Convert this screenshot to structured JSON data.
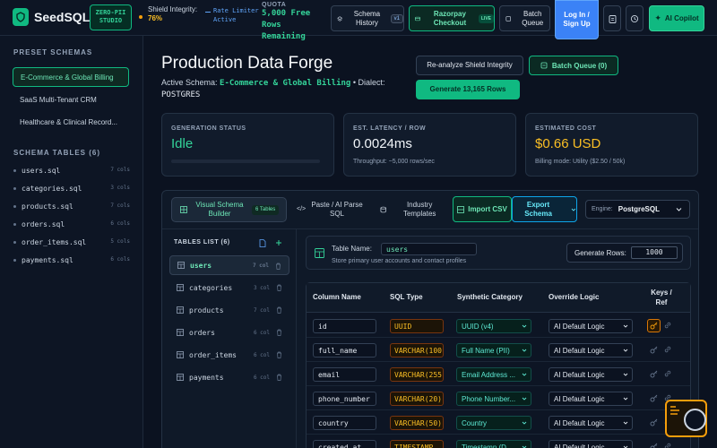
{
  "header": {
    "brand": "SeedSQL",
    "zero_pii": "ZERO-PII STUDIO",
    "shield_label": "Shield Integrity:",
    "shield_value": "76%",
    "rate_limiter": "Rate Limiter Active",
    "quota_label": "QUOTA",
    "quota_value": "5,000 Free Rows Remaining",
    "schema_history": "Schema History",
    "schema_version": "v1",
    "razorpay": "Razorpay Checkout",
    "live_badge": "LIVE",
    "batch_queue": "Batch Queue",
    "login": "Log In / Sign Up",
    "ai_copilot": "AI Copilot"
  },
  "sidebar": {
    "preset_heading": "PRESET SCHEMAS",
    "presets": [
      "E-Commerce & Global Billing",
      "SaaS Multi-Tenant CRM",
      "Healthcare & Clinical Record..."
    ],
    "tables_heading": "SCHEMA TABLES (6)",
    "tables": [
      {
        "name": "users.sql",
        "cols": "7 cols"
      },
      {
        "name": "categories.sql",
        "cols": "3 cols"
      },
      {
        "name": "products.sql",
        "cols": "7 cols"
      },
      {
        "name": "orders.sql",
        "cols": "6 cols"
      },
      {
        "name": "order_items.sql",
        "cols": "5 cols"
      },
      {
        "name": "payments.sql",
        "cols": "6 cols"
      }
    ]
  },
  "main": {
    "title": "Production Data Forge",
    "active_schema_label": "Active Schema:",
    "active_schema": "E-Commerce & Global Billing",
    "dialect_label": "• Dialect:",
    "dialect": "POSTGRES",
    "reanalyze": "Re-analyze Shield Integrity",
    "batch_queue": "Batch Queue (0)",
    "generate": "Generate 13,165 Rows"
  },
  "stats": {
    "status_label": "GENERATION STATUS",
    "status_value": "Idle",
    "status_progress": 0,
    "latency_label": "EST. LATENCY / ROW",
    "latency_value": "0.0024ms",
    "latency_sub": "Throughput: ~5,000 rows/sec",
    "cost_label": "ESTIMATED COST",
    "cost_value": "$0.66 USD",
    "cost_sub": "Billing mode: Utility ($2.50 / 50k)"
  },
  "builder": {
    "tabs": {
      "visual": "Visual Schema Builder",
      "visual_count": "6 Tables",
      "paste": "Paste / AI Parse SQL",
      "industry": "Industry Templates",
      "import": "Import CSV",
      "export": "Export Schema"
    },
    "engine_label": "Engine:",
    "engine_value": "PostgreSQL",
    "tables_list_heading": "TABLES LIST (6)",
    "tables": [
      {
        "name": "users",
        "cols": "7 col"
      },
      {
        "name": "categories",
        "cols": "3 col"
      },
      {
        "name": "products",
        "cols": "7 col"
      },
      {
        "name": "orders",
        "cols": "6 col"
      },
      {
        "name": "order_items",
        "cols": "6 col"
      },
      {
        "name": "payments",
        "cols": "6 col"
      }
    ],
    "table_name_label": "Table Name:",
    "table_name": "users",
    "table_desc": "Store primary user accounts and contact profiles",
    "gen_rows_label": "Generate Rows:",
    "gen_rows": "1000",
    "columns_header": {
      "name": "Column Name",
      "type": "SQL Type",
      "category": "Synthetic Category",
      "override": "Override Logic",
      "keys": "Keys / Ref"
    },
    "columns": [
      {
        "name": "id",
        "type": "UUID",
        "category": "UUID (v4)",
        "override": "AI Default Logic",
        "pk": true
      },
      {
        "name": "full_name",
        "type": "VARCHAR(100",
        "category": "Full Name (PII)",
        "override": "AI Default Logic",
        "pk": false
      },
      {
        "name": "email",
        "type": "VARCHAR(255",
        "category": "Email Address ...",
        "override": "AI Default Logic",
        "pk": false
      },
      {
        "name": "phone_number",
        "type": "VARCHAR(20)",
        "category": "Phone Number...",
        "override": "AI Default Logic",
        "pk": false
      },
      {
        "name": "country",
        "type": "VARCHAR(50)",
        "category": "Country",
        "override": "AI Default Logic",
        "pk": false
      },
      {
        "name": "created_at",
        "type": "TIMESTAMP",
        "category": "Timestamp (D...",
        "override": "AI Default Logic",
        "pk": false
      }
    ]
  },
  "colors": {
    "accent": "#10b981",
    "warning": "#fbbf24",
    "primary": "#3b82f6"
  }
}
